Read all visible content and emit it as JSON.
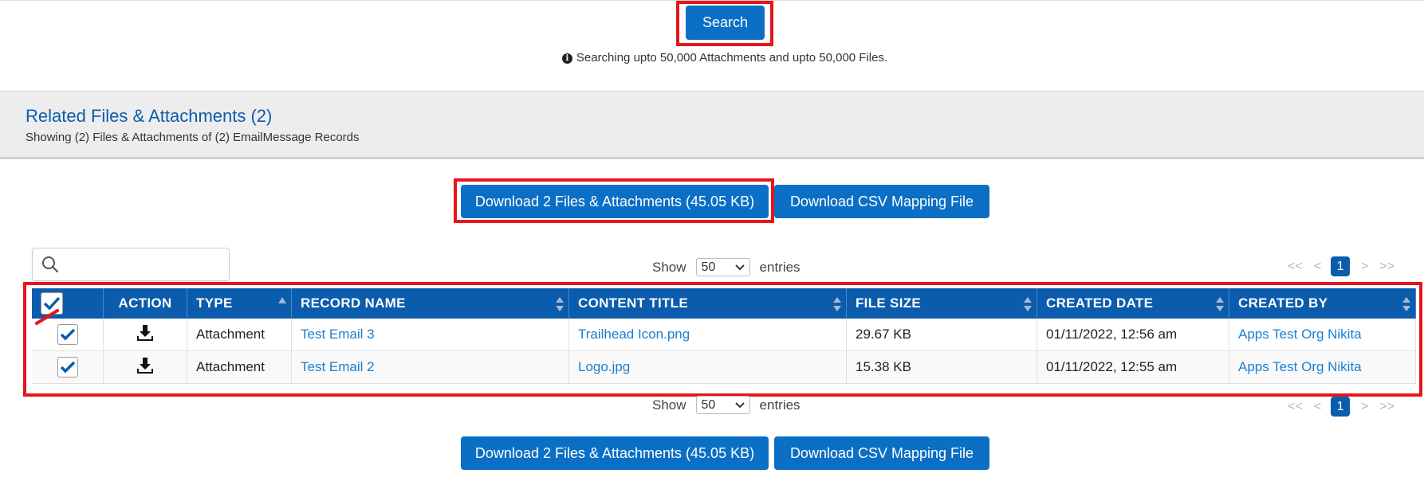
{
  "search": {
    "button_label": "Search"
  },
  "info": {
    "icon": "info-circle-icon",
    "text": "Searching upto 50,000 Attachments and upto 50,000 Files."
  },
  "section": {
    "title": "Related Files & Attachments (2)",
    "subtitle": "Showing (2) Files & Attachments of (2) EmailMessage Records"
  },
  "actions": {
    "download_label": "Download 2 Files & Attachments (45.05 KB)",
    "csv_label": "Download CSV Mapping File"
  },
  "table_controls": {
    "show_label": "Show",
    "entries_value": "50",
    "entries_label": "entries",
    "pager": {
      "first": "<<",
      "prev": "<",
      "current": "1",
      "next": ">",
      "last": ">>"
    }
  },
  "table": {
    "columns": [
      "ACTION",
      "TYPE",
      "RECORD NAME",
      "CONTENT TITLE",
      "FILE SIZE",
      "CREATED DATE",
      "CREATED BY"
    ],
    "rows": [
      {
        "checked": true,
        "type": "Attachment",
        "record_name": "Test Email 3",
        "content_title": "Trailhead Icon.png",
        "file_size": "29.67 KB",
        "created_date": "01/11/2022, 12:56 am",
        "created_by": "Apps Test Org Nikita"
      },
      {
        "checked": true,
        "type": "Attachment",
        "record_name": "Test Email 2",
        "content_title": "Logo.jpg",
        "file_size": "15.38 KB",
        "created_date": "01/11/2022, 12:55 am",
        "created_by": "Apps Test Org Nikita"
      }
    ]
  },
  "colors": {
    "primary": "#0b6fc5",
    "header": "#0b5cad",
    "link": "#1a7fd0",
    "highlight": "#e8141b"
  }
}
